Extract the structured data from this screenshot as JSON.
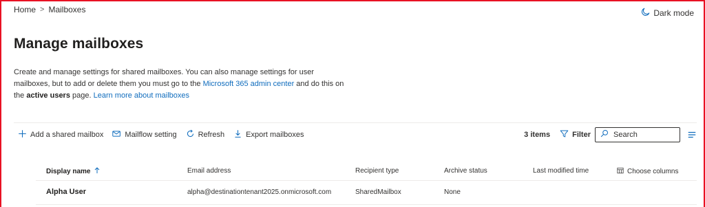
{
  "breadcrumb": {
    "home": "Home",
    "separator": ">",
    "current": "Mailboxes"
  },
  "dark_mode": {
    "label": "Dark mode",
    "icon": "moon-icon"
  },
  "page": {
    "title": "Manage mailboxes",
    "description": {
      "text_1": "Create and manage settings for shared mailboxes. You can also manage settings for user mailboxes, but to add or delete them you must go to the ",
      "link_admin": "Microsoft 365 admin center",
      "text_2": " and do this on the ",
      "bold": "active users",
      "text_3": " page. ",
      "link_learn": "Learn more about mailboxes"
    }
  },
  "toolbar": {
    "add_shared": {
      "label": "Add a shared mailbox",
      "icon": "plus-icon"
    },
    "mailflow": {
      "label": "Mailflow setting",
      "icon": "mail-settings-icon"
    },
    "refresh": {
      "label": "Refresh",
      "icon": "refresh-icon"
    },
    "export": {
      "label": "Export mailboxes",
      "icon": "download-icon"
    },
    "item_count": "3 items",
    "filter": {
      "label": "Filter",
      "icon": "filter-icon"
    },
    "search": {
      "placeholder": "Search",
      "value": "",
      "icon": "search-icon"
    },
    "view_options": {
      "icon": "view-options-icon"
    }
  },
  "table": {
    "columns": {
      "display_name": "Display name",
      "email": "Email address",
      "recipient_type": "Recipient type",
      "archive_status": "Archive status",
      "last_modified": "Last modified time",
      "choose_columns": "Choose columns"
    },
    "sort": {
      "column": "display_name",
      "direction": "ascending",
      "icon": "arrow-up-icon"
    },
    "rows": [
      {
        "display_name": "Alpha User",
        "email": "alpha@destinationtenant2025.onmicrosoft.com",
        "recipient_type": "SharedMailbox",
        "archive_status": "None",
        "last_modified": ""
      }
    ]
  },
  "colors": {
    "accent": "#0f6cbd",
    "border_highlight": "#e81123",
    "text": "#323130"
  }
}
